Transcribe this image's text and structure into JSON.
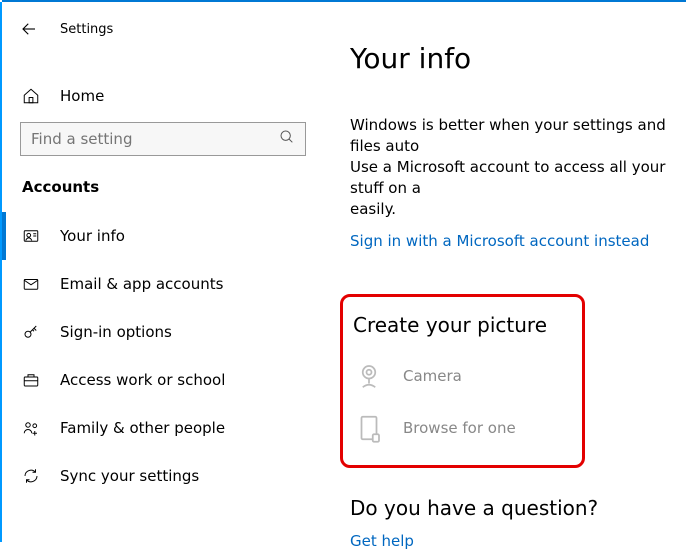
{
  "window": {
    "title": "Settings"
  },
  "sidebar": {
    "home": "Home",
    "search": {
      "placeholder": "Find a setting"
    },
    "sectionHeading": "Accounts",
    "items": [
      {
        "label": "Your info",
        "icon": "user-icon",
        "active": true
      },
      {
        "label": "Email & app accounts",
        "icon": "mail-icon",
        "active": false
      },
      {
        "label": "Sign-in options",
        "icon": "key-icon",
        "active": false
      },
      {
        "label": "Access work or school",
        "icon": "briefcase-icon",
        "active": false
      },
      {
        "label": "Family & other people",
        "icon": "family-icon",
        "active": false
      },
      {
        "label": "Sync your settings",
        "icon": "sync-icon",
        "active": false
      }
    ]
  },
  "main": {
    "pageTitle": "Your info",
    "infoLine1": "Windows is better when your settings and files auto",
    "infoLine2": "Use a Microsoft account to access all your stuff on a",
    "infoLine3": "easily.",
    "signinLink": "Sign in with a Microsoft account instead",
    "pictureHeading": "Create your picture",
    "cameraLabel": "Camera",
    "browseLabel": "Browse for one",
    "questionHeading": "Do you have a question?",
    "getHelp": "Get help"
  }
}
